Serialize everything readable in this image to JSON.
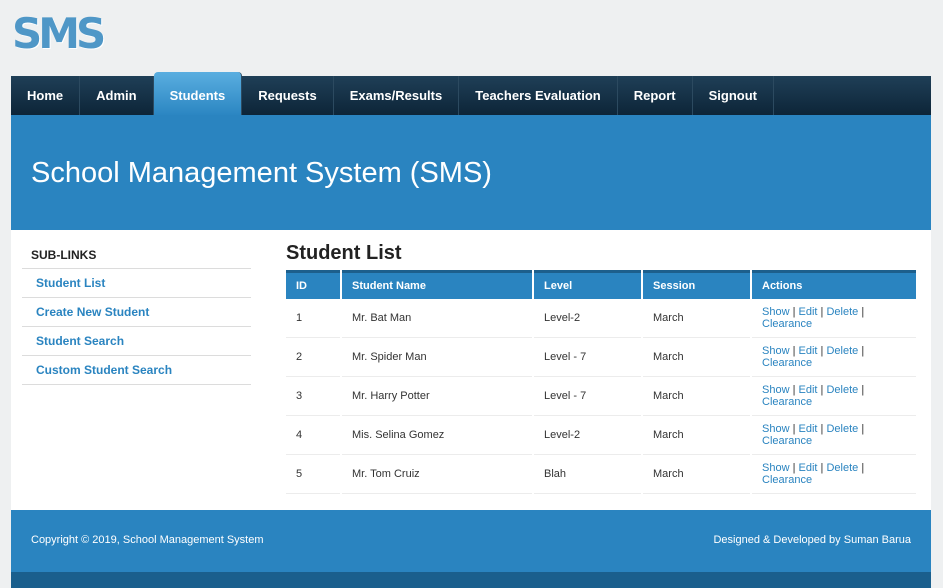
{
  "logo": "SMS",
  "nav": {
    "items": [
      "Home",
      "Admin",
      "Students",
      "Requests",
      "Exams/Results",
      "Teachers Evaluation",
      "Report",
      "Signout"
    ],
    "active": "Students"
  },
  "banner": {
    "title": "School Management System (SMS)"
  },
  "sidebar": {
    "title": "SUB-LINKS",
    "links": [
      "Student List",
      "Create New Student",
      "Student Search",
      "Custom Student Search"
    ]
  },
  "main": {
    "heading": "Student List",
    "columns": [
      "ID",
      "Student Name",
      "Level",
      "Session",
      "Actions"
    ],
    "rows": [
      {
        "id": "1",
        "name": "Mr. Bat Man",
        "level": "Level-2",
        "session": "March"
      },
      {
        "id": "2",
        "name": "Mr. Spider Man",
        "level": "Level - 7",
        "session": "March"
      },
      {
        "id": "3",
        "name": "Mr. Harry Potter",
        "level": "Level - 7",
        "session": "March"
      },
      {
        "id": "4",
        "name": "Mis. Selina Gomez",
        "level": "Level-2",
        "session": "March"
      },
      {
        "id": "5",
        "name": "Mr. Tom Cruiz",
        "level": "Blah",
        "session": "March"
      }
    ],
    "actions": {
      "show": "Show",
      "edit": "Edit",
      "delete": "Delete",
      "clearance": "Clearance",
      "separator": "|"
    }
  },
  "footer": {
    "copyright": "Copyright © 2019, School Management System",
    "credit": "Designed & Developed by Suman Barua"
  },
  "colors": {
    "accent": "#2a84c0",
    "nav_bg": "#0d2538",
    "logo": "#4f97c7"
  }
}
